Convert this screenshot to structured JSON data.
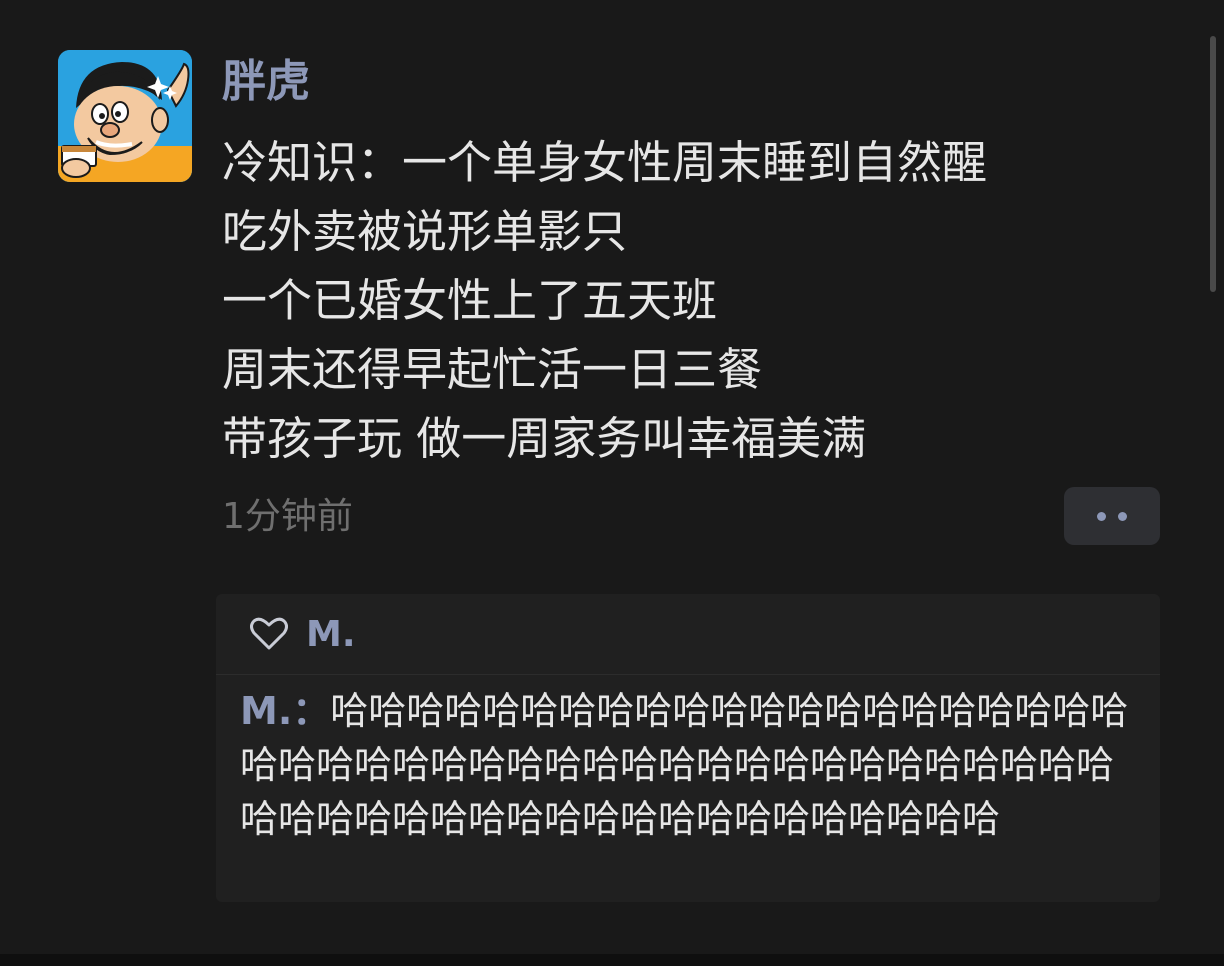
{
  "post": {
    "username": "胖虎",
    "avatar_icon": "cartoon-avatar",
    "lines": [
      "冷知识：一个单身女性周末睡到自然醒",
      "吃外卖被说形单影只",
      "一个已婚女性上了五天班",
      "周末还得早起忙活一日三餐",
      "带孩子玩 做一周家务叫幸福美满"
    ],
    "timestamp": "1分钟前",
    "more_icon": "more-dots-icon"
  },
  "likes": {
    "icon": "heart-outline-icon",
    "names": "M."
  },
  "comment": {
    "author": "M.",
    "separator": "：",
    "text": "哈哈哈哈哈哈哈哈哈哈哈哈哈哈哈哈哈哈哈哈哈哈哈哈哈哈哈哈哈哈哈哈哈哈哈哈哈哈哈哈哈哈哈哈哈哈哈哈哈哈哈哈哈哈哈哈哈哈哈哈哈哈哈哈"
  },
  "colors": {
    "background": "#191919",
    "name_blue": "#8d98b8",
    "text": "#e6e6e6",
    "muted": "#6f6f6f",
    "panel": "#202020"
  }
}
